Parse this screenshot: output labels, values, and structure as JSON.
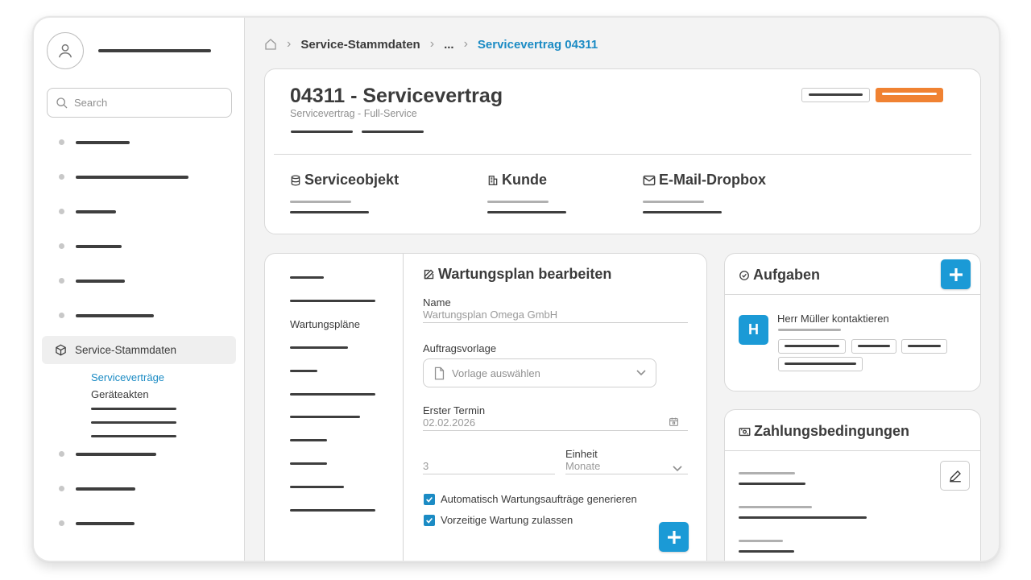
{
  "sidebar": {
    "search_placeholder": "Search",
    "active_item": "Service-Stammdaten",
    "sub_items": [
      "Serviceverträge",
      "Geräteakten"
    ]
  },
  "breadcrumb": {
    "items": [
      "Service-Stammdaten",
      "...",
      "Servicevertrag 04311"
    ]
  },
  "header": {
    "title": "04311 - Servicevertrag",
    "subtitle": "Servicevertrag - Full-Service",
    "sections": [
      "Serviceobjekt",
      "Kunde",
      "E-Mail-Dropbox"
    ]
  },
  "plan": {
    "nav_label": "Wartungspläne",
    "title": "Wartungsplan bearbeiten",
    "name_label": "Name",
    "name_value": "Wartungsplan Omega GmbH",
    "template_label": "Auftragsvorlage",
    "template_placeholder": "Vorlage auswählen",
    "first_date_label": "Erster Termin",
    "first_date_value": "02.02.2026",
    "interval_value": "3",
    "unit_label": "Einheit",
    "unit_value": "Monate",
    "check1": "Automatisch Wartungsaufträge generieren",
    "check2": "Vorzeitige Wartung zulassen"
  },
  "tasks": {
    "title": "Aufgaben",
    "avatar_letter": "H",
    "task_title": "Herr Müller kontaktieren"
  },
  "payment": {
    "title": "Zahlungsbedingungen"
  },
  "colors": {
    "accent": "#1b8bc4",
    "button_blue": "#1b9ad6",
    "orange": "#f08232"
  }
}
